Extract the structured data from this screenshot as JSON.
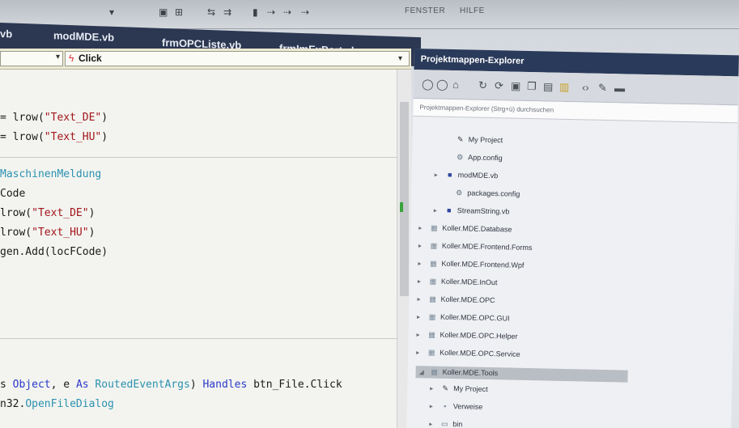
{
  "toolbar": {
    "menus": [
      "FENSTER",
      "HILFE"
    ]
  },
  "tabs": [
    {
      "label": "vb"
    },
    {
      "label": "modMDE.vb"
    },
    {
      "label": "frmOPCListe.vb"
    },
    {
      "label": "frmImExPort.vb"
    }
  ],
  "navbar": {
    "right_combo": "Click"
  },
  "code": {
    "l1_a": "= lrow(",
    "l1_b": "\"Text_DE\"",
    "l1_c": ")",
    "l2_a": "= lrow(",
    "l2_b": "\"Text_HU\"",
    "l2_c": ")",
    "l3": "MaschinenMeldung",
    "l4": "Code",
    "l5_a": "lrow(",
    "l5_b": "\"Text_DE\"",
    "l5_c": ")",
    "l6_a": "lrow(",
    "l6_b": "\"Text_HU\"",
    "l6_c": ")",
    "l7": "gen.Add(locFCode)",
    "l8_a": "s ",
    "l8_b": "Object",
    "l8_c": ", e ",
    "l8_d": "As",
    "l8_e": " RoutedEventArgs",
    "l8_f": ") ",
    "l8_g": "Handles",
    "l8_h": " btn_File.Click",
    "l9_a": "n32.",
    "l9_b": "OpenFileDialog"
  },
  "solution_explorer": {
    "title": "Projektmappen-Explorer",
    "search_placeholder": "Projektmappen-Explorer (Strg+ü) durchsuchen",
    "items": [
      {
        "label": "My Project",
        "icon": "wrench-icon"
      },
      {
        "label": "App.config",
        "icon": "config-file-icon"
      },
      {
        "label": "modMDE.vb",
        "icon": "vb-module-icon"
      },
      {
        "label": "packages.config",
        "icon": "config-file-icon"
      },
      {
        "label": "StreamString.vb",
        "icon": "vb-module-icon"
      },
      {
        "label": "Koller.MDE.Database",
        "icon": "project-icon"
      },
      {
        "label": "Koller.MDE.Frontend.Forms",
        "icon": "project-icon"
      },
      {
        "label": "Koller.MDE.Frontend.Wpf",
        "icon": "project-icon"
      },
      {
        "label": "Koller.MDE.InOut",
        "icon": "project-icon"
      },
      {
        "label": "Koller.MDE.OPC",
        "icon": "project-icon"
      },
      {
        "label": "Koller.MDE.OPC.GUI",
        "icon": "project-icon"
      },
      {
        "label": "Koller.MDE.OPC.Helper",
        "icon": "project-icon"
      },
      {
        "label": "Koller.MDE.OPC.Service",
        "icon": "project-icon"
      },
      {
        "label": "Koller.MDE.Tools",
        "icon": "project-icon"
      },
      {
        "label": "My Project",
        "icon": "wrench-icon"
      },
      {
        "label": "Verweise",
        "icon": "references-icon"
      },
      {
        "label": "bin",
        "icon": "folder-icon"
      }
    ]
  },
  "colors": {
    "tab_bar": "#2c3852",
    "keyword": "#2a39c9",
    "string": "#a3151a",
    "type": "#2b91af",
    "solution_title": "#2a3a5a"
  }
}
